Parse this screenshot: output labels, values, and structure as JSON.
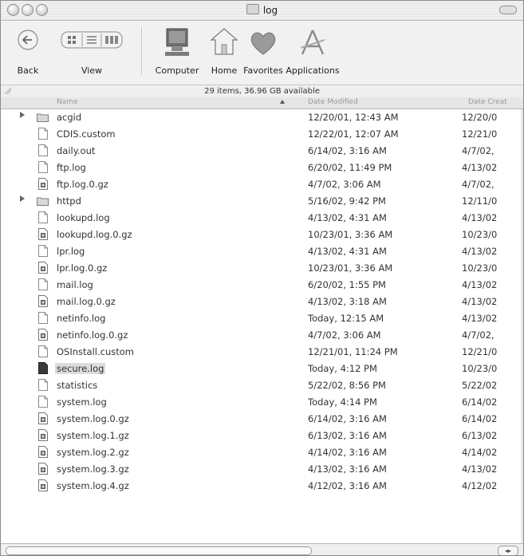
{
  "window": {
    "title": "log",
    "status": "29 items, 36.96 GB available"
  },
  "toolbar": {
    "back_label": "Back",
    "view_label": "View",
    "computer_label": "Computer",
    "home_label": "Home",
    "favorites_label": "Favorites",
    "applications_label": "Applications"
  },
  "columns": {
    "name": "Name",
    "date_modified": "Date Modified",
    "date_created": "Date Creat"
  },
  "files": [
    {
      "name": "acgid",
      "modified": "12/20/01, 12:43 AM",
      "created": "12/20/0",
      "kind": "folder"
    },
    {
      "name": "CDIS.custom",
      "modified": "12/22/01, 12:07 AM",
      "created": "12/21/0",
      "kind": "doc"
    },
    {
      "name": "daily.out",
      "modified": "6/14/02, 3:16 AM",
      "created": "4/7/02,",
      "kind": "doc"
    },
    {
      "name": "ftp.log",
      "modified": "6/20/02, 11:49 PM",
      "created": "4/13/02",
      "kind": "doc"
    },
    {
      "name": "ftp.log.0.gz",
      "modified": "4/7/02, 3:06 AM",
      "created": "4/7/02,",
      "kind": "gz"
    },
    {
      "name": "httpd",
      "modified": "5/16/02, 9:42 PM",
      "created": "12/11/0",
      "kind": "folder"
    },
    {
      "name": "lookupd.log",
      "modified": "4/13/02, 4:31 AM",
      "created": "4/13/02",
      "kind": "doc"
    },
    {
      "name": "lookupd.log.0.gz",
      "modified": "10/23/01, 3:36 AM",
      "created": "10/23/0",
      "kind": "gz"
    },
    {
      "name": "lpr.log",
      "modified": "4/13/02, 4:31 AM",
      "created": "4/13/02",
      "kind": "doc"
    },
    {
      "name": "lpr.log.0.gz",
      "modified": "10/23/01, 3:36 AM",
      "created": "10/23/0",
      "kind": "gz"
    },
    {
      "name": "mail.log",
      "modified": "6/20/02, 1:55 PM",
      "created": "4/13/02",
      "kind": "doc"
    },
    {
      "name": "mail.log.0.gz",
      "modified": "4/13/02, 3:18 AM",
      "created": "4/13/02",
      "kind": "gz"
    },
    {
      "name": "netinfo.log",
      "modified": "Today, 12:15 AM",
      "created": "4/13/02",
      "kind": "doc"
    },
    {
      "name": "netinfo.log.0.gz",
      "modified": "4/7/02, 3:06 AM",
      "created": "4/7/02,",
      "kind": "gz"
    },
    {
      "name": "OSInstall.custom",
      "modified": "12/21/01, 11:24 PM",
      "created": "12/21/0",
      "kind": "doc"
    },
    {
      "name": "secure.log",
      "modified": "Today, 4:12 PM",
      "created": "10/23/0",
      "kind": "dark",
      "selected": true
    },
    {
      "name": "statistics",
      "modified": "5/22/02, 8:56 PM",
      "created": "5/22/02",
      "kind": "doc"
    },
    {
      "name": "system.log",
      "modified": "Today, 4:14 PM",
      "created": "6/14/02",
      "kind": "doc"
    },
    {
      "name": "system.log.0.gz",
      "modified": "6/14/02, 3:16 AM",
      "created": "6/14/02",
      "kind": "gz"
    },
    {
      "name": "system.log.1.gz",
      "modified": "6/13/02, 3:16 AM",
      "created": "6/13/02",
      "kind": "gz"
    },
    {
      "name": "system.log.2.gz",
      "modified": "4/14/02, 3:16 AM",
      "created": "4/14/02",
      "kind": "gz"
    },
    {
      "name": "system.log.3.gz",
      "modified": "4/13/02, 3:16 AM",
      "created": "4/13/02",
      "kind": "gz"
    },
    {
      "name": "system.log.4.gz",
      "modified": "4/12/02, 3:16 AM",
      "created": "4/12/02",
      "kind": "gz"
    }
  ],
  "icons": {
    "folder": "folder-icon",
    "doc": "document-icon",
    "gz": "archive-icon",
    "dark": "locked-document-icon"
  },
  "colors": {
    "selection": "#dcdcdc",
    "text": "#333333",
    "chrome": "#ececec"
  }
}
